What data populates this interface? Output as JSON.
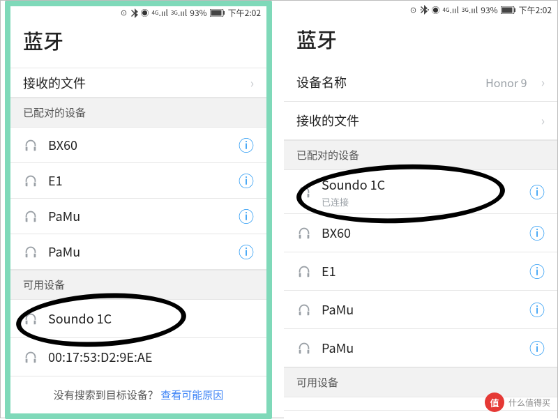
{
  "status": {
    "battery": "93%",
    "time": "下午2:02"
  },
  "common": {
    "title": "蓝牙",
    "received_files": "接收的文件",
    "paired": "已配对的设备",
    "available": "可用设备",
    "device_name_label": "设备名称",
    "connected": "已连接"
  },
  "left": {
    "paired": [
      {
        "name": "BX60"
      },
      {
        "name": "E1"
      },
      {
        "name": "PaMu"
      },
      {
        "name": "PaMu"
      }
    ],
    "available": [
      {
        "name": "Soundo 1C"
      },
      {
        "name": "00:17:53:D2:9E:AE"
      }
    ],
    "footer": {
      "q": "没有搜索到目标设备？",
      "link": "查看可能原因"
    }
  },
  "right": {
    "device_name_value": "Honor 9",
    "paired": [
      {
        "name": "Soundo 1C",
        "sub": "已连接"
      },
      {
        "name": "BX60"
      },
      {
        "name": "E1"
      },
      {
        "name": "PaMu"
      },
      {
        "name": "PaMu"
      }
    ]
  },
  "watermark": {
    "badge": "值",
    "text": "什么值得买"
  }
}
